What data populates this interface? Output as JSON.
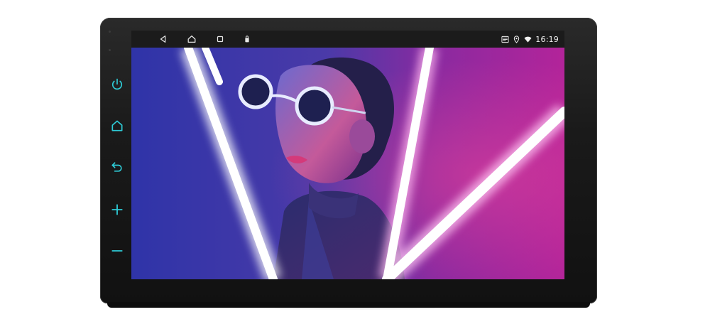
{
  "device": {
    "side_keys": [
      {
        "name": "power",
        "icon": "power-icon"
      },
      {
        "name": "home",
        "icon": "home-icon"
      },
      {
        "name": "back",
        "icon": "back-icon"
      },
      {
        "name": "volume-up",
        "icon": "plus-icon"
      },
      {
        "name": "volume-down",
        "icon": "minus-icon"
      }
    ],
    "key_color": "#2ecbd6"
  },
  "statusbar": {
    "nav": [
      "back-triangle-icon",
      "home-outline-icon",
      "recents-square-icon",
      "bag-icon"
    ],
    "indicators": [
      "notification-icon",
      "location-icon",
      "wifi-icon"
    ],
    "time": "16:19"
  },
  "wallpaper": {
    "subject": "portrait-with-neon-lights",
    "colors": {
      "left": "#3a36a8",
      "right": "#b0249a",
      "neon": "#ffffff"
    }
  }
}
